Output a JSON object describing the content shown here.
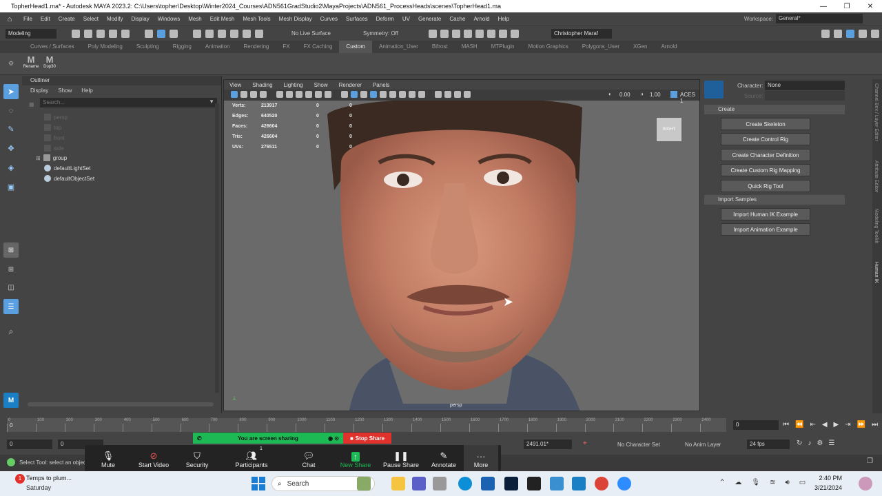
{
  "window": {
    "title": "TopherHead1.ma* - Autodesk MAYA 2023.2: C:\\Users\\topher\\Desktop\\Winter2024_Courses\\ADN561GradStudio2\\MayaProjects\\ADN561_ProcessHeads\\scenes\\TopherHead1.ma",
    "controls": [
      "—",
      "❐",
      "✕"
    ]
  },
  "menubar": {
    "items": [
      "File",
      "Edit",
      "Create",
      "Select",
      "Modify",
      "Display",
      "Windows",
      "Mesh",
      "Edit Mesh",
      "Mesh Tools",
      "Mesh Display",
      "Curves",
      "Surfaces",
      "Deform",
      "UV",
      "Generate",
      "Cache",
      "Arnold",
      "Help"
    ],
    "workspace_label": "Workspace:",
    "workspace_value": "General*"
  },
  "statusline": {
    "menu_set": "Modeling",
    "live_surface": "No Live Surface",
    "symmetry": "Symmetry: Off",
    "user": "Christopher Maraf"
  },
  "shelf": {
    "tabs": [
      "Curves / Surfaces",
      "Poly Modeling",
      "Sculpting",
      "Rigging",
      "Animation",
      "Rendering",
      "FX",
      "FX Caching",
      "Custom",
      "Animation_User",
      "Bifrost",
      "MASH",
      "MTPlugin",
      "Motion Graphics",
      "Polygons_User",
      "XGen",
      "Arnold"
    ],
    "active_tab": "Custom",
    "buttons": [
      {
        "glyph": "M",
        "label": "Rename"
      },
      {
        "glyph": "M",
        "label": "Dup30"
      }
    ]
  },
  "outliner": {
    "title": "Outliner",
    "menu": [
      "Display",
      "Show",
      "Help"
    ],
    "search_placeholder": "Search...",
    "items": [
      {
        "label": "persp",
        "dim": true
      },
      {
        "label": "top",
        "dim": true
      },
      {
        "label": "front",
        "dim": true
      },
      {
        "label": "side",
        "dim": true
      },
      {
        "label": "group",
        "dim": false
      },
      {
        "label": "defaultLightSet",
        "dim": false
      },
      {
        "label": "defaultObjectSet",
        "dim": false
      }
    ]
  },
  "viewport": {
    "menu": [
      "View",
      "Shading",
      "Lighting",
      "Show",
      "Renderer",
      "Panels"
    ],
    "exposure": "0.00",
    "gamma": "1.00",
    "color_space": "ACES 1",
    "hud": [
      {
        "label": "Verts:",
        "value": "213917",
        "a": "0",
        "b": "0"
      },
      {
        "label": "Edges:",
        "value": "640520",
        "a": "0",
        "b": "0"
      },
      {
        "label": "Faces:",
        "value": "426604",
        "a": "0",
        "b": "0"
      },
      {
        "label": "Tris:",
        "value": "426604",
        "a": "0",
        "b": "0"
      },
      {
        "label": "UVs:",
        "value": "276511",
        "a": "0",
        "b": "0"
      }
    ],
    "viewcube_label": "RIGHT",
    "camera_label": "persp"
  },
  "humanik": {
    "character_label": "Character:",
    "character_value": "None",
    "source_label": "Source:",
    "create_header": "Create",
    "create_buttons": [
      "Create Skeleton",
      "Create Control Rig",
      "Create Character Definition",
      "Create Custom Rig Mapping",
      "Quick Rig Tool"
    ],
    "import_header": "Import Samples",
    "import_buttons": [
      "Import Human IK Example",
      "Import Animation Example"
    ]
  },
  "side_tabs": [
    "Channel Box / Layer Editor",
    "Attribute Editor",
    "Modeling Toolkit",
    "Human IK"
  ],
  "timeline": {
    "ticks": [
      "0",
      "100",
      "200",
      "300",
      "400",
      "500",
      "600",
      "700",
      "800",
      "900",
      "1000",
      "1100",
      "1200",
      "1300",
      "1400",
      "1500",
      "1600",
      "1700",
      "1800",
      "1900",
      "2000",
      "2100",
      "2200",
      "2300",
      "2400"
    ],
    "current_frame": "0",
    "range_start": "0",
    "range_inner_start": "0",
    "range_end_value": "2491.01*",
    "character_set": "No Character Set",
    "anim_layer": "No Anim Layer",
    "fps": "24 fps"
  },
  "help_line": "Select Tool: select an object",
  "screen_share": {
    "message": "You are screen sharing",
    "stop_label": "Stop Share"
  },
  "zoom_controls": [
    {
      "name": "mute",
      "label": "Mute"
    },
    {
      "name": "start-video",
      "label": "Start Video"
    },
    {
      "name": "security",
      "label": "Security"
    },
    {
      "name": "participants",
      "label": "Participants",
      "count": "1"
    },
    {
      "name": "chat",
      "label": "Chat"
    },
    {
      "name": "new-share",
      "label": "New Share"
    },
    {
      "name": "pause-share",
      "label": "Pause Share"
    },
    {
      "name": "annotate",
      "label": "Annotate"
    },
    {
      "name": "more",
      "label": "More"
    }
  ],
  "taskbar": {
    "weather_title": "Temps to plum...",
    "weather_sub": "Saturday",
    "search_placeholder": "Search",
    "time": "2:40 PM",
    "date": "3/21/2024"
  },
  "colors": {
    "maya_bg": "#444444",
    "viewport_bg": "#6a6a6a",
    "share_green": "#1db954",
    "stop_red": "#e0312b",
    "zoom_bar": "#232323",
    "accent_blue": "#5aa0e0"
  }
}
